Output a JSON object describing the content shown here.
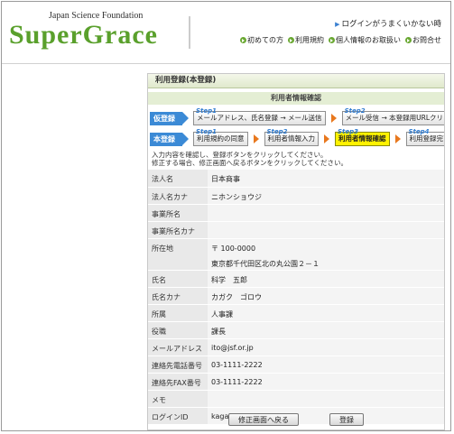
{
  "header": {
    "logo_sub": "Japan Science Foundation",
    "logo": "SuperGrace",
    "login_link": "ログインがうまくいかない時",
    "nav": [
      "初めての方",
      "利用規約",
      "個人情報のお取扱い",
      "お問合せ"
    ]
  },
  "panel": {
    "title": "利用登録(本登録)",
    "section_title": "利用者情報確認"
  },
  "steps": {
    "provisional_tag": "仮登録",
    "provisional": [
      {
        "no": "Step1",
        "label": "メールアドレス、氏名登録 → メール送信"
      },
      {
        "no": "Step2",
        "label": "メール受信 → 本登録用URLクリック"
      }
    ],
    "main_tag": "本登録",
    "main": [
      {
        "no": "Step1",
        "label": "利用規約の同意"
      },
      {
        "no": "Step2",
        "label": "利用者情報入力"
      },
      {
        "no": "Step3",
        "label": "利用者情報確認"
      },
      {
        "no": "Step4",
        "label": "利用登録完了"
      }
    ]
  },
  "note": {
    "line1": "入力内容を確認し、登録ボタンをクリックしてください。",
    "line2": "修正する場合、修正画面へ戻るボタンをクリックしてください。"
  },
  "form": [
    {
      "label": "法人名",
      "value": "日本商事"
    },
    {
      "label": "法人名カナ",
      "value": "ニホンショウジ"
    },
    {
      "label": "事業所名",
      "value": ""
    },
    {
      "label": "事業所名カナ",
      "value": ""
    },
    {
      "label": "所在地",
      "value": "〒 100-0000",
      "value2": "東京都千代田区北の丸公園２－１"
    },
    {
      "label": "氏名",
      "value": "科学　五郎"
    },
    {
      "label": "氏名カナ",
      "value": "カガク　ゴロウ"
    },
    {
      "label": "所属",
      "value": "人事課"
    },
    {
      "label": "役職",
      "value": "課長"
    },
    {
      "label": "メールアドレス",
      "value": "ito@jsf.or.jp"
    },
    {
      "label": "連絡先電話番号",
      "value": "03-1111-2222"
    },
    {
      "label": "連絡先FAX番号",
      "value": "03-1111-2222"
    },
    {
      "label": "メモ",
      "value": ""
    },
    {
      "label": "ログインID",
      "value": "kagaku_goro"
    }
  ],
  "buttons": {
    "back": "修正画面へ戻る",
    "register": "登録"
  },
  "colors": {
    "brand": "#5aa02c",
    "step_tag": "#3b8ad6",
    "active_step": "#fff200",
    "arrow": "#e8781e"
  }
}
